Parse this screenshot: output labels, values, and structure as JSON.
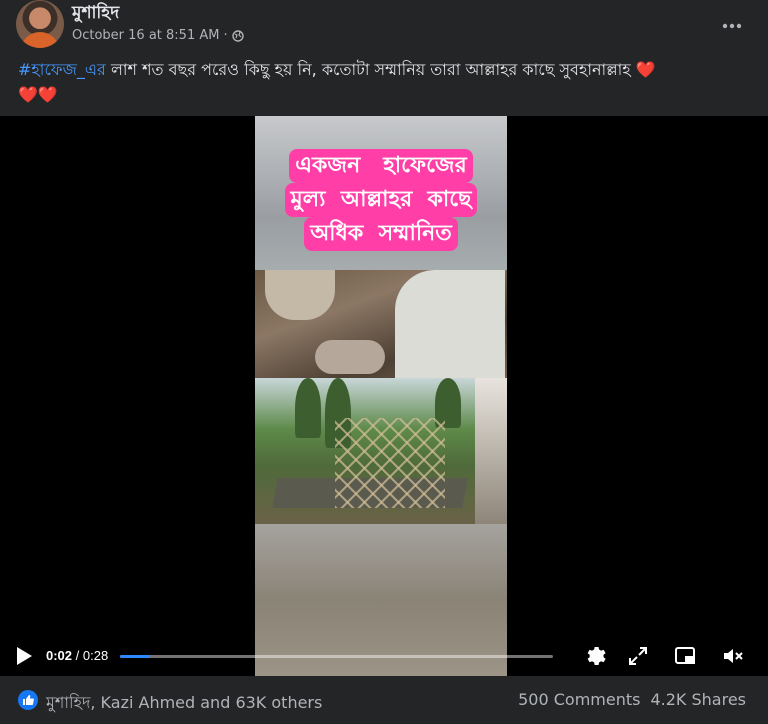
{
  "post": {
    "author": "মুশাহিদ",
    "timestamp": "October 16 at 8:51 AM",
    "separator": "·",
    "privacy_icon": "globe-icon",
    "more_icon": "more-horizontal-icon"
  },
  "caption": {
    "hashtag": "#হাফেজ_এর",
    "text": " লাশ শত বছর পরেও কিছু হয় নি, কতোটা  সম্মানিয় তারা আল্লাহর কাছে সুবহানাল্লাহ ",
    "hearts_inline": "❤️",
    "hearts_line2": "❤️❤️"
  },
  "video": {
    "overlay_lines": [
      "একজন   হাফেজের",
      "মুল্য  আল্লাহর  কাছে",
      "অধিক  সম্মানিত"
    ],
    "current_time": "0:02",
    "separator": " / ",
    "duration": "0:28",
    "progress": 0.07,
    "icons": [
      "play-icon",
      "settings-icon",
      "fullscreen-icon",
      "pip-icon",
      "mute-icon"
    ]
  },
  "engagement": {
    "reactors": "মুশাহিদ, Kazi Ahmed and 63K others",
    "comments": "500 Comments",
    "shares": "4.2K Shares"
  },
  "colors": {
    "background": "#242526",
    "hashtag": "#4599ff",
    "overlay_pink": "#ff3ea7",
    "progress_blue": "#2d88ff",
    "like_blue": "#1877f2"
  }
}
